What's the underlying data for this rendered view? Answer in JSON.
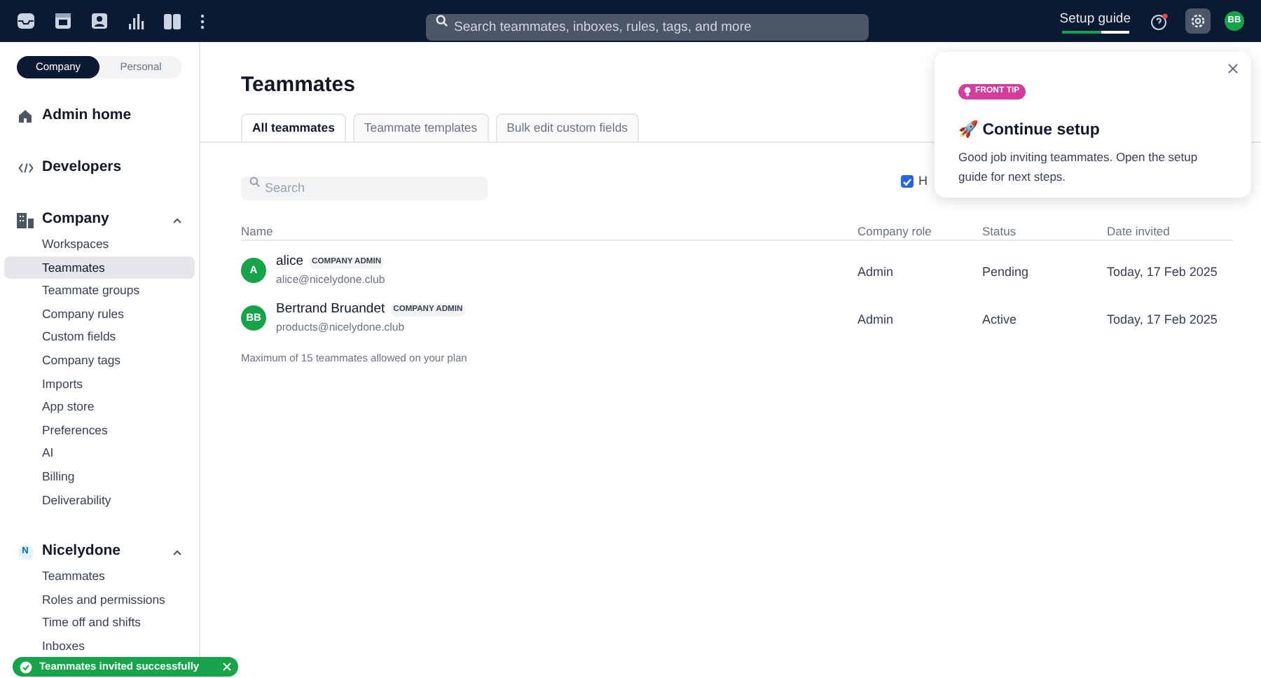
{
  "topbar": {
    "search": {
      "placeholder": "Search teammates, inboxes, rules, tags, and more"
    },
    "setup_guide": {
      "label": "Setup guide",
      "level": 0.6
    },
    "avatar": "BB"
  },
  "sidebar": {
    "scope_tabs": [
      {
        "label": "Company",
        "selected": true
      },
      {
        "label": "Personal",
        "selected": false
      }
    ],
    "sections": [
      {
        "kind": "link",
        "label": "Admin home"
      },
      {
        "kind": "link",
        "label": "Developers"
      },
      {
        "kind": "group",
        "label": "Company",
        "expanded": true,
        "items": [
          {
            "label": "Workspaces",
            "selected": false
          },
          {
            "label": "Teammates",
            "selected": true
          },
          {
            "label": "Teammate groups",
            "selected": false
          },
          {
            "label": "Company rules",
            "selected": false
          },
          {
            "label": "Custom fields",
            "selected": false
          },
          {
            "label": "Company tags",
            "selected": false
          },
          {
            "label": "Imports",
            "selected": false
          },
          {
            "label": "App store",
            "selected": false
          },
          {
            "label": "Preferences",
            "selected": false
          },
          {
            "label": "AI",
            "selected": false
          },
          {
            "label": "Billing",
            "selected": false
          },
          {
            "label": "Deliverability",
            "selected": false
          }
        ]
      },
      {
        "kind": "group",
        "label": "Nicelydone",
        "badge": "N",
        "expanded": true,
        "items": [
          {
            "label": "Teammates",
            "selected": false
          },
          {
            "label": "Roles and permissions",
            "selected": false
          },
          {
            "label": "Time off and shifts",
            "selected": false
          },
          {
            "label": "Inboxes",
            "selected": false
          }
        ]
      }
    ]
  },
  "page": {
    "title": "Teammates",
    "tabs": [
      {
        "label": "All teammates",
        "selected": true
      },
      {
        "label": "Teammate templates",
        "selected": false
      },
      {
        "label": "Bulk edit custom fields",
        "selected": false
      }
    ],
    "search": {
      "placeholder": "Search"
    },
    "checkbox": {
      "label": "H",
      "checked": true
    },
    "table": {
      "columns": [
        "Name",
        "Company role",
        "Status",
        "Date invited"
      ],
      "rows": [
        {
          "initials": "A",
          "name": "alice",
          "badge": "COMPANY ADMIN",
          "email": "alice@nicelydone.club",
          "role": "Admin",
          "status": "Pending",
          "date": "Today, 17 Feb 2025"
        },
        {
          "initials": "BB",
          "name": "Bertrand Bruandet",
          "badge": "COMPANY ADMIN",
          "email": "products@nicelydone.club",
          "role": "Admin",
          "status": "Active",
          "date": "Today, 17 Feb 2025"
        }
      ]
    },
    "footnote": "Maximum of 15 teammates allowed on your plan"
  },
  "popover": {
    "tag": "FRONT TIP",
    "title": "🚀 Continue setup",
    "body": "Good job inviting teammates. Open the setup guide for next steps."
  },
  "toast": {
    "message": "Teammates invited successfully"
  }
}
